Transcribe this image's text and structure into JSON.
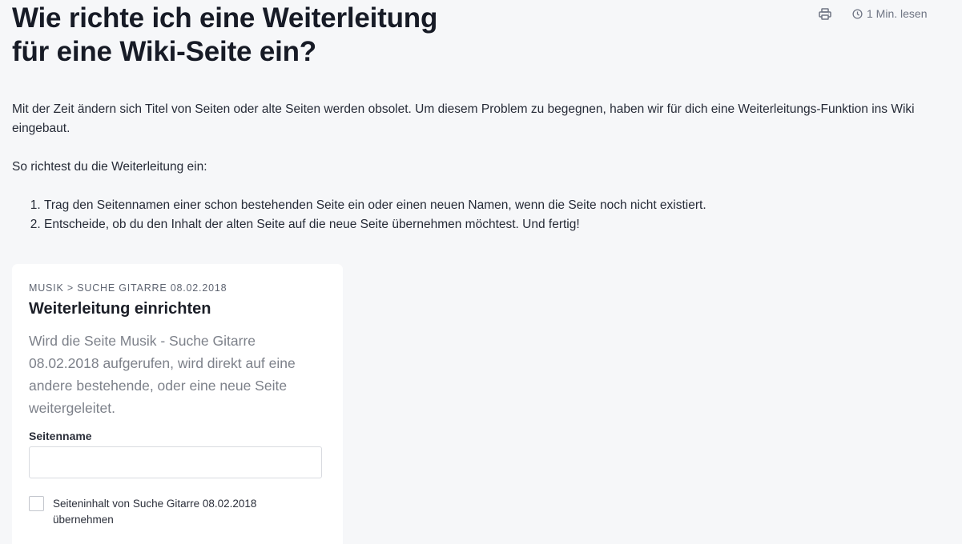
{
  "article": {
    "title_line1": "Wie richte ich eine Weiterleitung",
    "title_line2": "für eine Wiki-Seite ein?",
    "read_time": "1 Min. lesen",
    "intro": "Mit der Zeit ändern sich Titel von Seiten oder alte Seiten werden obsolet. Um diesem Problem zu begegnen, haben wir für dich eine Weiterleitungs-Funktion ins Wiki eingebaut.",
    "howto": "So richtest du die Weiterleitung ein:",
    "steps": [
      "Trag den Seitennamen einer schon bestehenden Seite ein oder einen neuen Namen, wenn die Seite noch nicht existiert.",
      "Entscheide, ob du den Inhalt der alten Seite auf die neue Seite übernehmen möchtest. Und fertig!"
    ]
  },
  "icons": {
    "print": "printer-icon",
    "read_time": "clock-icon"
  },
  "card": {
    "breadcrumb": "MUSIK > SUCHE GITARRE 08.02.2018",
    "title": "Weiterleitung einrichten",
    "description": "Wird die Seite Musik - Suche Gitarre 08.02.2018 aufgerufen, wird direkt auf eine andere bestehende, oder eine neue Seite weitergeleitet.",
    "field_label": "Seitenname",
    "field_value": "",
    "field_placeholder": "",
    "checkbox_label": "Seiteninhalt von Suche Gitarre 08.02.2018 übernehmen",
    "checkbox_checked": false
  },
  "colors": {
    "background": "#f6f7f9",
    "card": "#ffffff",
    "heading": "#171b26",
    "muted": "#6e7483"
  }
}
